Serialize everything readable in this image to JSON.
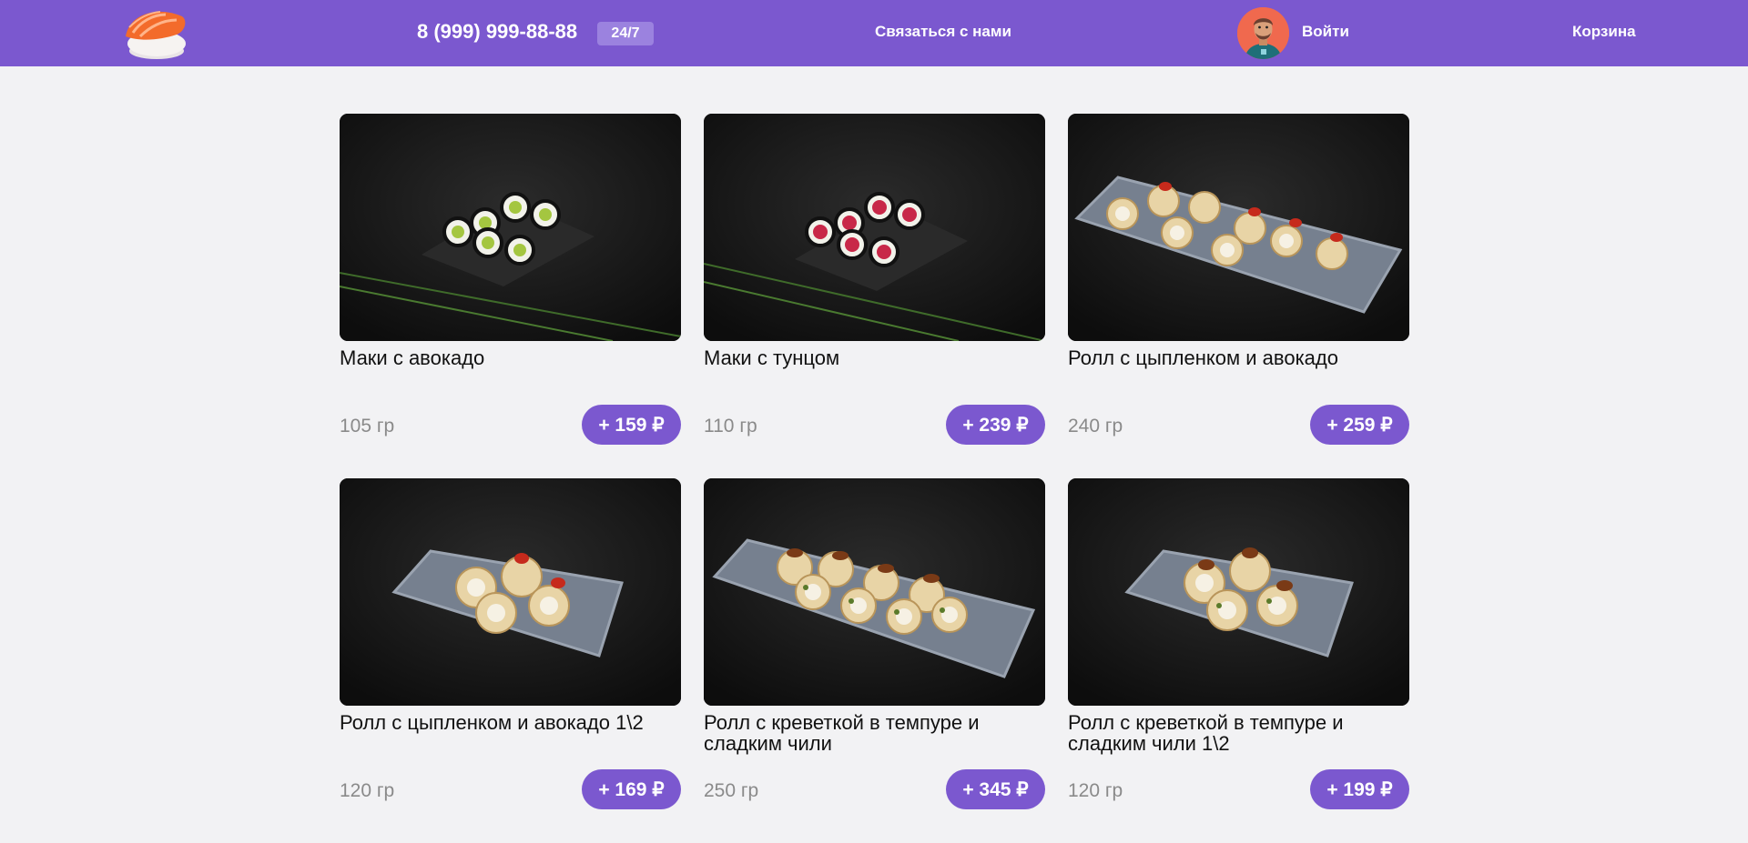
{
  "header": {
    "logo_icon": "sushi-nigiri-logo-icon",
    "phone": "8 (999) 999-88-88",
    "hours_badge": "24/7",
    "contact_label": "Связаться с нами",
    "avatar_icon": "user-avatar-icon",
    "login_label": "Войти",
    "cart_label": "Корзина",
    "accent_color": "#7b58cf"
  },
  "products": [
    {
      "name": "Маки с авокадо",
      "weight": "105 гр",
      "price": "+ 159 ₽",
      "image": "maki-avocado-photo"
    },
    {
      "name": "Маки с тунцом",
      "weight": "110 гр",
      "price": "+ 239 ₽",
      "image": "maki-tuna-photo"
    },
    {
      "name": "Ролл с цыпленком и авокадо",
      "weight": "240 гр",
      "price": "+ 259 ₽",
      "image": "roll-chicken-avocado-photo"
    },
    {
      "name": "Ролл с цыпленком и авокадо 1\\2",
      "weight": "120 гр",
      "price": "+ 169 ₽",
      "image": "roll-chicken-avocado-half-photo"
    },
    {
      "name": "Ролл с креветкой в темпуре и сладким чили",
      "weight": "250 гр",
      "price": "+ 345 ₽",
      "image": "roll-shrimp-tempura-photo"
    },
    {
      "name": "Ролл с креветкой в темпуре и сладким чили 1\\2",
      "weight": "120 гр",
      "price": "+ 199 ₽",
      "image": "roll-shrimp-tempura-half-photo"
    }
  ]
}
